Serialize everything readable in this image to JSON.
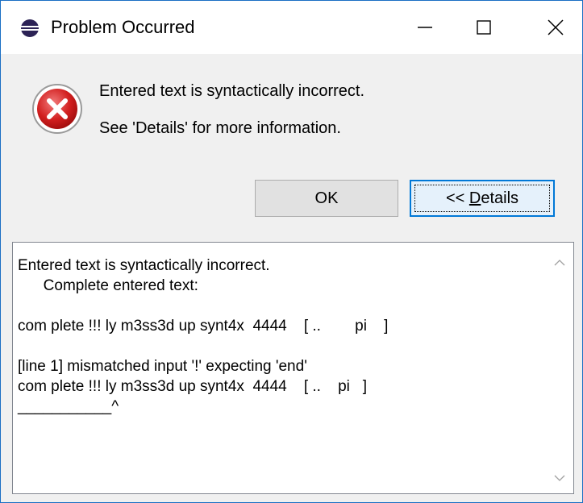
{
  "window": {
    "title": "Problem Occurred",
    "controls": {
      "minimize_icon": "minimize-icon",
      "maximize_icon": "maximize-icon",
      "close_icon": "close-icon"
    }
  },
  "dialog": {
    "icon": "error-icon",
    "message": "Entered text is syntactically incorrect.",
    "hint": "See 'Details' for more information.",
    "buttons": {
      "ok": "OK",
      "details_prefix": "<< ",
      "details_mnemonic": "D",
      "details_rest": "etails"
    }
  },
  "details": {
    "text": "Entered text is syntactically incorrect.\n      Complete entered text:\n\ncom plete !!! ly m3ss3d up synt4x  4444    [ ..        pi    ]\n\n[line 1] mismatched input '!' expecting 'end'\ncom plete !!! ly m3ss3d up synt4x  4444    [ ..    pi   ]\n___________^"
  },
  "colors": {
    "accent": "#0078d7",
    "error_red": "#c8102e",
    "window_border": "#1a6fc4"
  }
}
